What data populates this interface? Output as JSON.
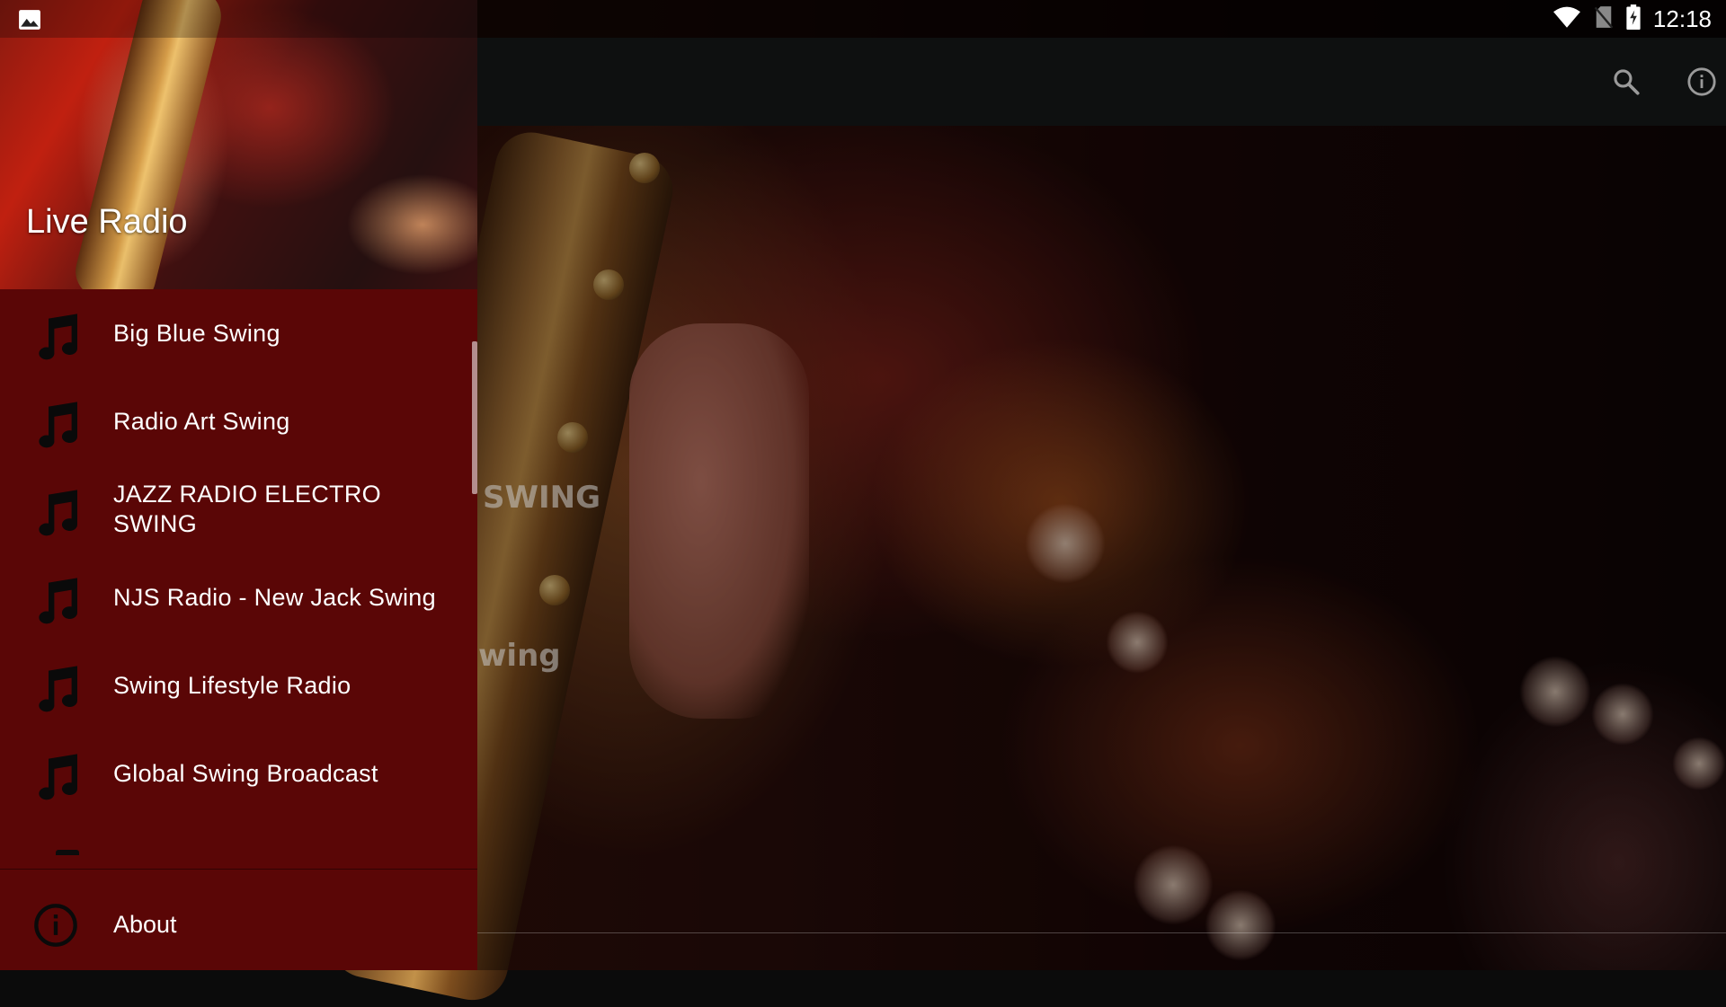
{
  "status_bar": {
    "time": "12:18",
    "icons": [
      "image-notification-icon",
      "wifi-icon",
      "no-sim-icon",
      "battery-charging-icon"
    ]
  },
  "toolbar": {
    "icons": [
      "search-icon",
      "info-icon"
    ]
  },
  "background": {
    "fragment_1": "SWING",
    "fragment_2": "wing"
  },
  "drawer": {
    "header_title": "Live Radio",
    "items": [
      {
        "label": "Big Blue Swing",
        "icon": "music-note-icon"
      },
      {
        "label": "Radio Art Swing",
        "icon": "music-note-icon"
      },
      {
        "label": "JAZZ RADIO ELECTRO SWING",
        "icon": "music-note-icon"
      },
      {
        "label": "NJS Radio - New Jack Swing",
        "icon": "music-note-icon"
      },
      {
        "label": "Swing Lifestyle Radio",
        "icon": "music-note-icon"
      },
      {
        "label": "Global Swing Broadcast",
        "icon": "music-note-icon"
      }
    ],
    "about_label": "About"
  },
  "colors": {
    "drawer_bg": "#5a0606",
    "toolbar_bg": "#0e1010",
    "text": "#ffffff"
  }
}
